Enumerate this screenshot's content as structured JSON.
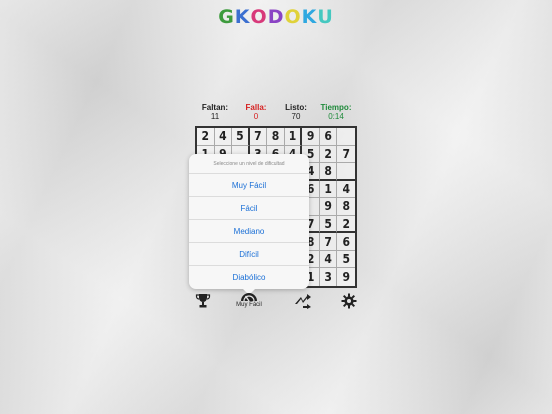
{
  "app": {
    "logo_letters": [
      "G",
      "K",
      "O",
      "D",
      "O",
      "K",
      "U"
    ],
    "logo_colors": [
      "#3d9b3d",
      "#3b6fd0",
      "#d8397a",
      "#8a43c4",
      "#e0d23a",
      "#2fa8e0",
      "#45c8c0"
    ]
  },
  "stats": {
    "faltan": {
      "label": "Faltan:",
      "value": "11"
    },
    "fallas": {
      "label": "Falla:",
      "value": "0"
    },
    "listo": {
      "label": "Listo:",
      "value": "70"
    },
    "tiempo": {
      "label": "Tiempo:",
      "value": "0:14"
    }
  },
  "board": {
    "rows": [
      [
        "2",
        "4",
        "5",
        "7",
        "8",
        "1",
        "9",
        "6",
        ""
      ],
      [
        "1",
        "9",
        "",
        "3",
        "6",
        "4",
        "5",
        "2",
        "7"
      ],
      [
        "",
        "",
        "",
        "",
        "",
        "",
        "4",
        "8",
        ""
      ],
      [
        "",
        "",
        "",
        "",
        "",
        "",
        "6",
        "1",
        "4"
      ],
      [
        "",
        "",
        "",
        "",
        "",
        "",
        "",
        "9",
        "8"
      ],
      [
        "",
        "",
        "",
        "",
        "",
        "",
        "7",
        "5",
        "2"
      ],
      [
        "",
        "",
        "",
        "",
        "",
        "",
        "8",
        "7",
        "6"
      ],
      [
        "",
        "",
        "",
        "",
        "",
        "",
        "2",
        "4",
        "5"
      ],
      [
        "",
        "",
        "",
        "",
        "",
        "",
        "1",
        "3",
        "9"
      ]
    ]
  },
  "difficulty_popover": {
    "title": "Seleccione un nivel de dificultad",
    "options": [
      "Muy Fácil",
      "Fácil",
      "Mediano",
      "Difícil",
      "Diabólico"
    ]
  },
  "toolbar": {
    "trophy": {
      "icon": "trophy-icon"
    },
    "difficulty": {
      "icon": "difficulty-gauge-icon",
      "label": "Muy Fácil"
    },
    "shuffle": {
      "icon": "shuffle-icon"
    },
    "settings": {
      "icon": "gear-icon"
    }
  },
  "colors": {
    "fallas_accent": "#d62020",
    "tiempo_accent": "#1e8a3a",
    "option_link": "#1a6fd6"
  }
}
